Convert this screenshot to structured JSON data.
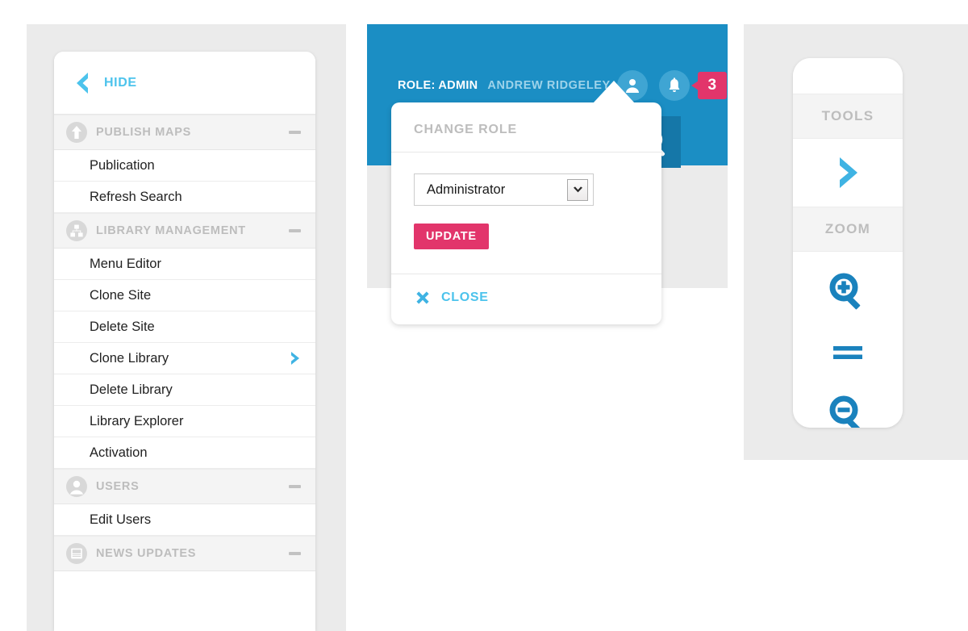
{
  "colors": {
    "header_blue": "#1b8ec4",
    "search_blue": "#1577a8",
    "cyan_accent": "#4cc3ec",
    "pink_accent": "#e2356b",
    "zoom_icon_blue": "#1a82bd",
    "panel_grey": "#ebebeb",
    "section_grey": "#f4f4f4",
    "muted_label": "#bdbdbd"
  },
  "sidebar": {
    "hide": {
      "label": "HIDE",
      "icon": "chevron-left-icon"
    },
    "sections": [
      {
        "id": "publish-maps",
        "title": "PUBLISH MAPS",
        "icon": "upload-circle-icon",
        "collapse": "minus",
        "items": [
          {
            "label": "Publication",
            "chevron": false
          },
          {
            "label": "Refresh Search",
            "chevron": false
          }
        ]
      },
      {
        "id": "library-management",
        "title": "LIBRARY MANAGEMENT",
        "icon": "sitemap-circle-icon",
        "collapse": "minus",
        "items": [
          {
            "label": "Menu Editor",
            "chevron": false
          },
          {
            "label": "Clone Site",
            "chevron": false
          },
          {
            "label": "Delete Site",
            "chevron": false
          },
          {
            "label": "Clone Library",
            "chevron": true
          },
          {
            "label": "Delete Library",
            "chevron": false
          },
          {
            "label": "Library Explorer",
            "chevron": false
          },
          {
            "label": "Activation",
            "chevron": false
          }
        ]
      },
      {
        "id": "users",
        "title": "USERS",
        "icon": "user-circle-icon",
        "collapse": "minus",
        "items": [
          {
            "label": "Edit Users",
            "chevron": false
          }
        ]
      },
      {
        "id": "news-updates",
        "title": "NEWS UPDATES",
        "icon": "newspaper-circle-icon",
        "collapse": "minus",
        "items": []
      }
    ]
  },
  "header": {
    "role_label": "ROLE: ADMIN",
    "user_name": "ANDREW RIDGELEY",
    "avatar_icon": "user-avatar-icon",
    "bell_icon": "bell-icon",
    "notification_count": "3",
    "search_icon": "search-icon"
  },
  "popup": {
    "title": "CHANGE ROLE",
    "select": {
      "value": "Administrator",
      "options": [
        "Administrator"
      ]
    },
    "update_label": "UPDATE",
    "close_label": "CLOSE",
    "close_icon": "close-x-icon"
  },
  "tools_panel": {
    "tools_title": "TOOLS",
    "tools_arrow_icon": "chevron-right-icon",
    "zoom_title": "ZOOM",
    "zoom_buttons": [
      {
        "name": "zoom-in-icon"
      },
      {
        "name": "zoom-reset-icon"
      },
      {
        "name": "zoom-out-icon"
      }
    ]
  }
}
